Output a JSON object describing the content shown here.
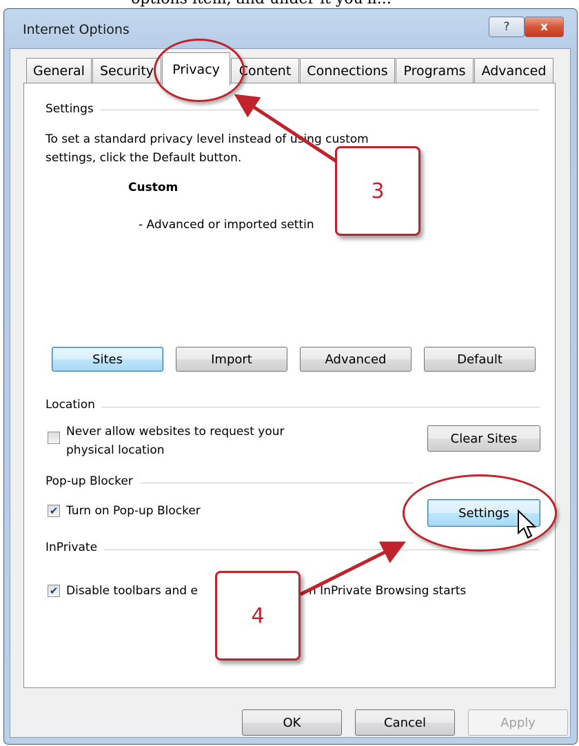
{
  "top_fragment": "options item, and under it you'll...",
  "window": {
    "title": "Internet Options",
    "help_glyph": "?",
    "close_glyph": "x"
  },
  "tabs": [
    {
      "label": "General"
    },
    {
      "label": "Security"
    },
    {
      "label": "Privacy",
      "active": true
    },
    {
      "label": "Content"
    },
    {
      "label": "Connections"
    },
    {
      "label": "Programs"
    },
    {
      "label": "Advanced"
    }
  ],
  "settings": {
    "heading": "Settings",
    "desc_line1": "To set a standard privacy level instead of using custom",
    "desc_line2": "settings, click the Default button.",
    "level": "Custom",
    "level_desc": "- Advanced or imported settin"
  },
  "privacy_buttons": {
    "sites": "Sites",
    "import": "Import",
    "advanced": "Advanced",
    "default": "Default"
  },
  "location": {
    "heading": "Location",
    "checkbox_line1": "Never allow websites to request your",
    "checkbox_line2": "physical location",
    "checked": false,
    "clear_sites": "Clear Sites"
  },
  "popup": {
    "heading": "Pop-up Blocker",
    "checkbox_label": "Turn on Pop-up Blocker",
    "checked": true,
    "settings_button": "Settings"
  },
  "inprivate": {
    "heading": "InPrivate",
    "checkbox_label_left": "Disable toolbars and e",
    "checkbox_label_right": "n InPrivate Browsing starts",
    "checked": true
  },
  "footer": {
    "ok": "OK",
    "cancel": "Cancel",
    "apply": "Apply"
  },
  "annotations": {
    "step3": "3",
    "step4": "4",
    "color": "#c0232b"
  },
  "colors": {
    "title_bar": "#b9d0ea",
    "focused_button": "#bee6fd",
    "annotation": "#c0232b"
  },
  "icons": {
    "check": "check-mark",
    "cursor": "pointer-cursor"
  }
}
